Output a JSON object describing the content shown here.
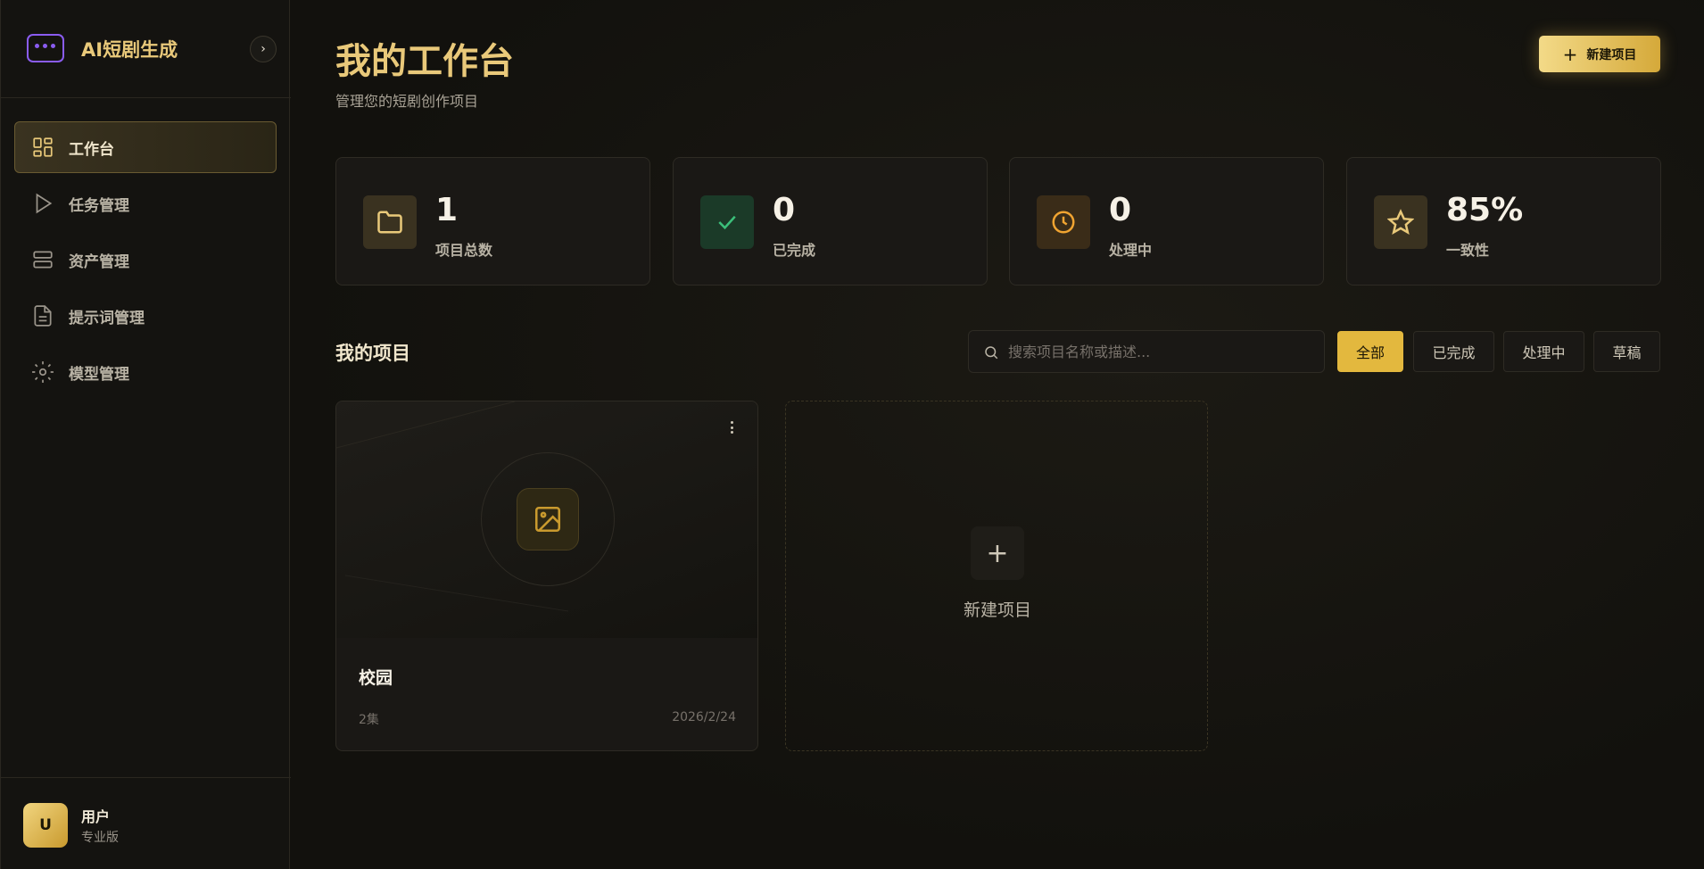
{
  "brand": {
    "title": "AI短剧生成"
  },
  "sidebar": {
    "items": [
      {
        "label": "工作台",
        "icon": "dashboard-icon",
        "active": true
      },
      {
        "label": "任务管理",
        "icon": "play-icon",
        "active": false
      },
      {
        "label": "资产管理",
        "icon": "server-icon",
        "active": false
      },
      {
        "label": "提示词管理",
        "icon": "document-icon",
        "active": false
      },
      {
        "label": "模型管理",
        "icon": "settings-icon",
        "active": false
      }
    ]
  },
  "user": {
    "initial": "U",
    "name": "用户",
    "plan": "专业版"
  },
  "header": {
    "title": "我的工作台",
    "subtitle": "管理您的短剧创作项目",
    "new_button": "新建项目"
  },
  "stats": [
    {
      "value": "1",
      "label": "项目总数",
      "icon": "folder-icon",
      "color": "#e9c97a"
    },
    {
      "value": "0",
      "label": "已完成",
      "icon": "check-icon",
      "color": "#3bbf7a"
    },
    {
      "value": "0",
      "label": "处理中",
      "icon": "clock-icon",
      "color": "#f0a431"
    },
    {
      "value": "85%",
      "label": "一致性",
      "icon": "star-icon",
      "color": "#e9c97a"
    }
  ],
  "projects": {
    "title": "我的项目",
    "search_placeholder": "搜索项目名称或描述...",
    "filters": [
      "全部",
      "已完成",
      "处理中",
      "草稿"
    ],
    "active_filter": "全部",
    "cards": [
      {
        "title": "校园",
        "episodes": "2集",
        "date": "2026/2/24"
      }
    ],
    "new_card_label": "新建项目"
  },
  "colors": {
    "accent": "#e9c97a",
    "accent_button": "#e3b83e",
    "background": "#12110d"
  }
}
